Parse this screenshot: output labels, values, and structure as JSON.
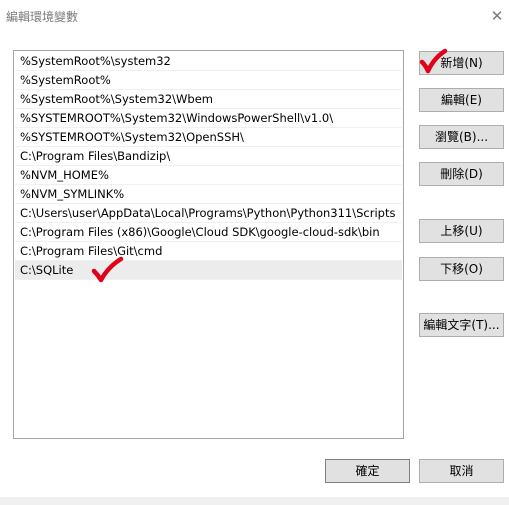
{
  "window": {
    "title": "編輯環境變數",
    "close_glyph": "✕"
  },
  "paths": [
    "%SystemRoot%\\system32",
    "%SystemRoot%",
    "%SystemRoot%\\System32\\Wbem",
    "%SYSTEMROOT%\\System32\\WindowsPowerShell\\v1.0\\",
    "%SYSTEMROOT%\\System32\\OpenSSH\\",
    "C:\\Program Files\\Bandizip\\",
    "%NVM_HOME%",
    "%NVM_SYMLINK%",
    "C:\\Users\\user\\AppData\\Local\\Programs\\Python\\Python311\\Scripts",
    "C:\\Program Files (x86)\\Google\\Cloud SDK\\google-cloud-sdk\\bin",
    "C:\\Program Files\\Git\\cmd",
    "C:\\SQLite"
  ],
  "buttons": {
    "new": "新增(N)",
    "edit": "編輯(E)",
    "browse": "瀏覽(B)...",
    "delete": "刪除(D)",
    "move_up": "上移(U)",
    "move_down": "下移(O)",
    "edit_text": "編輯文字(T)...",
    "ok": "確定",
    "cancel": "取消"
  },
  "colors": {
    "annotation_check": "#e0001a",
    "selection": "#ececec"
  }
}
